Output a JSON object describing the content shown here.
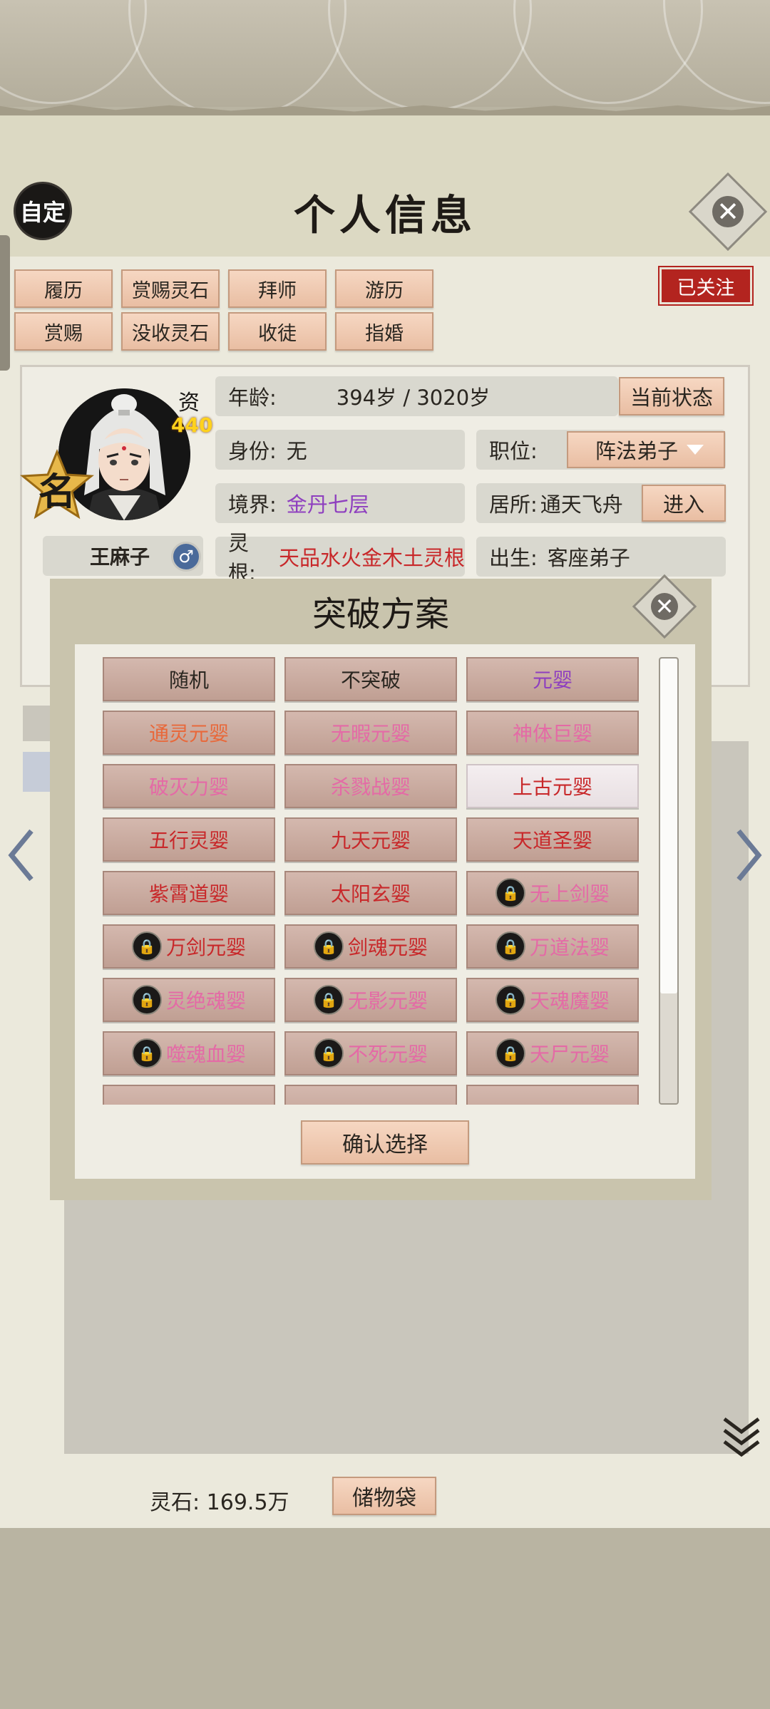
{
  "header": {
    "title": "个人信息",
    "custom_label": "自定",
    "close_label": "✕"
  },
  "tabs": [
    [
      "履历",
      "赏赐灵石",
      "拜师",
      "游历"
    ],
    [
      "赏赐",
      "没收灵石",
      "收徒",
      "指婚"
    ]
  ],
  "follow_label": "已关注",
  "profile": {
    "name_badge": "名",
    "aptitude_label": "资",
    "aptitude_value": "440",
    "name": "王麻子",
    "gender_icon": "male-icon",
    "age_label": "年龄:",
    "age_value": "394岁 / 3020岁",
    "status_button": "当前状态",
    "identity_label": "身份:",
    "identity_value": "无",
    "position_label": "职位:",
    "position_value": "阵法弟子",
    "realm_label": "境界:",
    "realm_value": "金丹七层",
    "residence_label": "居所:",
    "residence_value": "通天飞舟",
    "enter_button": "进入",
    "root_label": "灵根:",
    "root_value": "天品水火金木土灵根",
    "origin_label": "出生:",
    "origin_value": "客座弟子"
  },
  "modal": {
    "title": "突破方案",
    "close_label": "✕",
    "confirm_label": "确认选择",
    "options": [
      {
        "label": "随机",
        "color": "#2a2620",
        "locked": false,
        "selected": false
      },
      {
        "label": "不突破",
        "color": "#2a2620",
        "locked": false,
        "selected": false
      },
      {
        "label": "元婴",
        "color": "#8e3fbf",
        "locked": false,
        "selected": false
      },
      {
        "label": "通灵元婴",
        "color": "#e8683a",
        "locked": false,
        "selected": false
      },
      {
        "label": "无暇元婴",
        "color": "#e46aa6",
        "locked": false,
        "selected": false
      },
      {
        "label": "神体巨婴",
        "color": "#e46aa6",
        "locked": false,
        "selected": false
      },
      {
        "label": "破灭力婴",
        "color": "#e46aa6",
        "locked": false,
        "selected": false
      },
      {
        "label": "杀戮战婴",
        "color": "#e46aa6",
        "locked": false,
        "selected": false
      },
      {
        "label": "上古元婴",
        "color": "#c8282a",
        "locked": false,
        "selected": true
      },
      {
        "label": "五行灵婴",
        "color": "#c8282a",
        "locked": false,
        "selected": false
      },
      {
        "label": "九天元婴",
        "color": "#c8282a",
        "locked": false,
        "selected": false
      },
      {
        "label": "天道圣婴",
        "color": "#c8282a",
        "locked": false,
        "selected": false
      },
      {
        "label": "紫霄道婴",
        "color": "#c8282a",
        "locked": false,
        "selected": false
      },
      {
        "label": "太阳玄婴",
        "color": "#c8282a",
        "locked": false,
        "selected": false
      },
      {
        "label": "无上剑婴",
        "color": "#e46aa6",
        "locked": true,
        "selected": false
      },
      {
        "label": "万剑元婴",
        "color": "#c8282a",
        "locked": true,
        "selected": false
      },
      {
        "label": "剑魂元婴",
        "color": "#c8282a",
        "locked": true,
        "selected": false
      },
      {
        "label": "万道法婴",
        "color": "#e46aa6",
        "locked": true,
        "selected": false
      },
      {
        "label": "灵绝魂婴",
        "color": "#e46aa6",
        "locked": true,
        "selected": false
      },
      {
        "label": "无影元婴",
        "color": "#e46aa6",
        "locked": true,
        "selected": false
      },
      {
        "label": "天魂魔婴",
        "color": "#e46aa6",
        "locked": true,
        "selected": false
      },
      {
        "label": "噬魂血婴",
        "color": "#e46aa6",
        "locked": true,
        "selected": false
      },
      {
        "label": "不死元婴",
        "color": "#e46aa6",
        "locked": true,
        "selected": false
      },
      {
        "label": "天尸元婴",
        "color": "#e46aa6",
        "locked": true,
        "selected": false
      }
    ]
  },
  "footer": {
    "spirit_stone_label": "灵石:",
    "spirit_stone_value": "169.5万",
    "bag_button": "储物袋"
  },
  "nav": {
    "prev_icon": "chevron-left-icon",
    "next_icon": "chevron-right-icon",
    "more_icon": "double-chevron-down-icon"
  }
}
